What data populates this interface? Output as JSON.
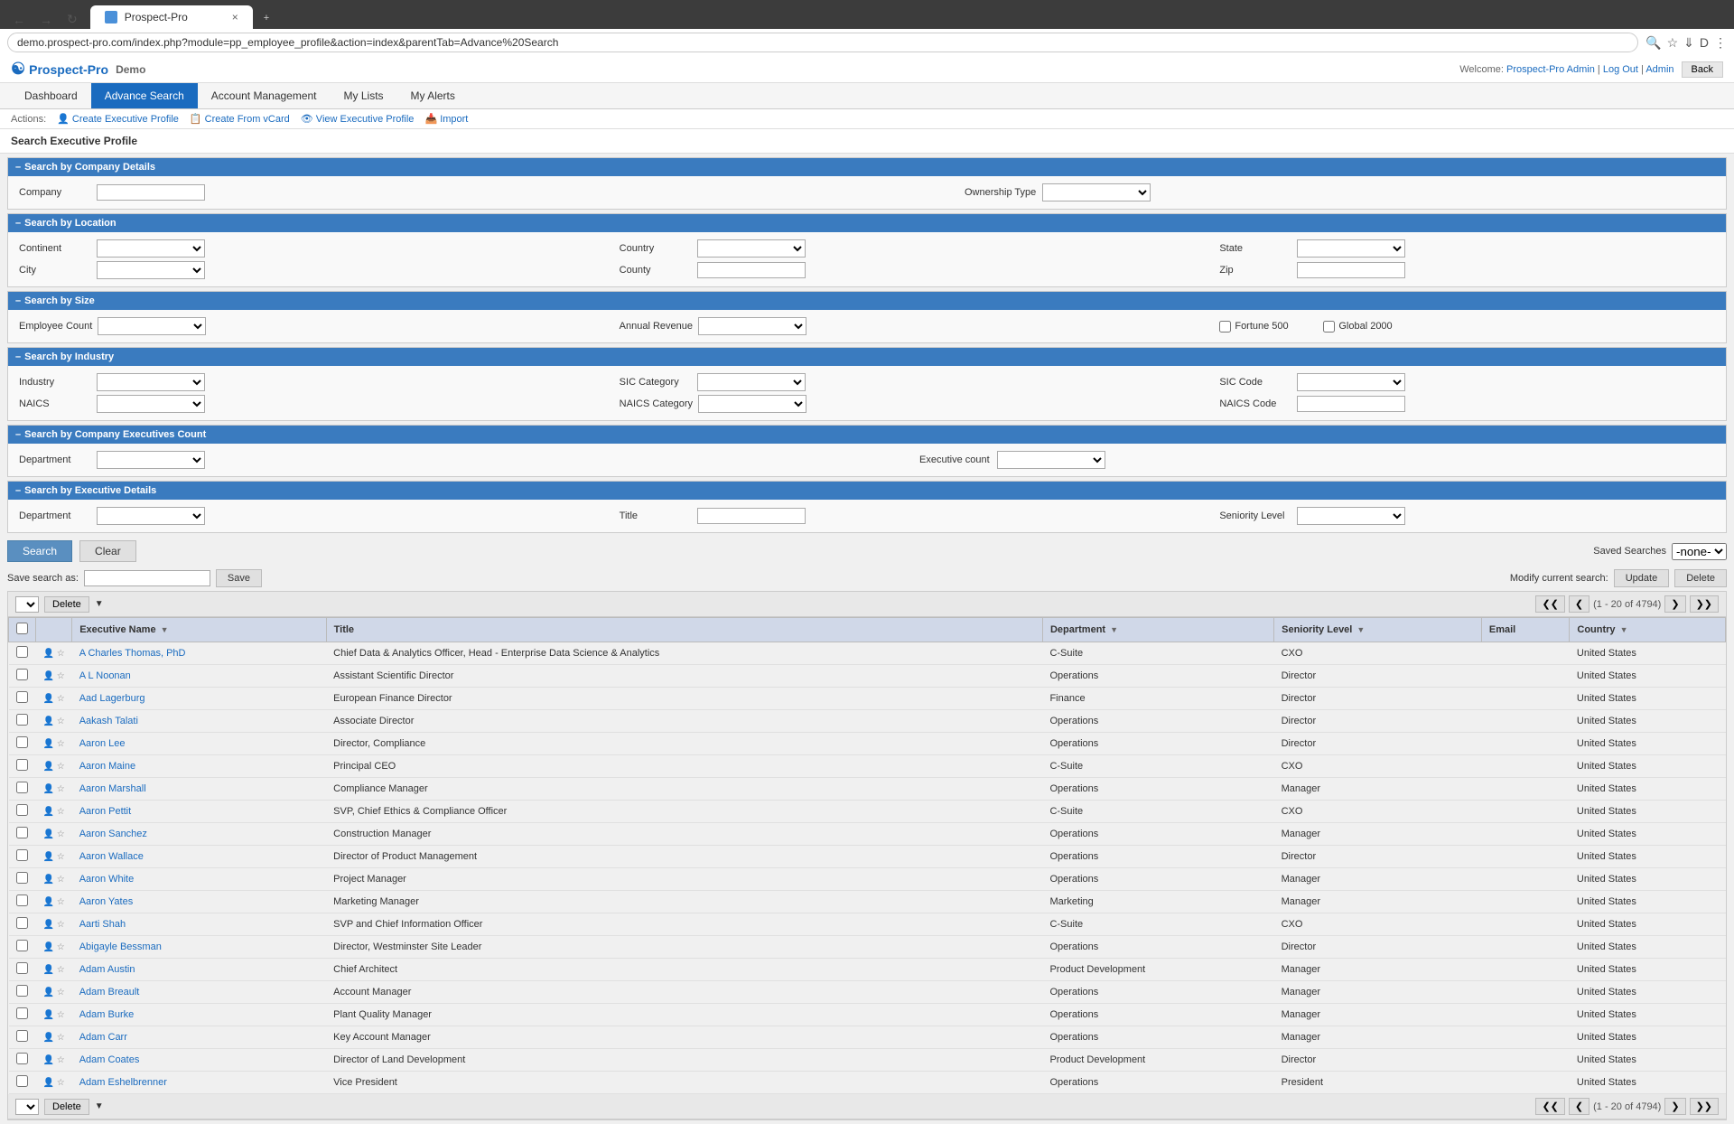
{
  "browser": {
    "tab_title": "Prospect-Pro",
    "url": "demo.prospect-pro.com/index.php?module=pp_employee_profile&action=index&parentTab=Advance%20Search",
    "tab_close": "×",
    "new_tab": "+"
  },
  "app": {
    "logo": "Prospect-Pro",
    "demo_label": "Demo",
    "welcome": "Welcome:",
    "welcome_user": "Prospect-Pro Admin",
    "separator": "|",
    "log_out": "Log Out",
    "admin_link": "Admin",
    "back_btn": "Back"
  },
  "nav": {
    "tabs": [
      {
        "label": "Dashboard",
        "active": false
      },
      {
        "label": "Advance Search",
        "active": true
      },
      {
        "label": "Account Management",
        "active": false
      },
      {
        "label": "My Lists",
        "active": false
      },
      {
        "label": "My Alerts",
        "active": false
      }
    ]
  },
  "actions": {
    "label": "Actions:",
    "items": [
      {
        "icon": "👤",
        "label": "Create Executive Profile"
      },
      {
        "icon": "📋",
        "label": "Create From vCard"
      },
      {
        "icon": "👁",
        "label": "View Executive Profile"
      },
      {
        "icon": "📥",
        "label": "Import"
      }
    ]
  },
  "page_title": "Search Executive Profile",
  "sections": {
    "company_details": {
      "title": "Search by Company Details",
      "company_label": "Company",
      "ownership_label": "Ownership Type"
    },
    "location": {
      "title": "Search by Location",
      "continent_label": "Continent",
      "country_label": "Country",
      "state_label": "State",
      "city_label": "City",
      "county_label": "County",
      "zip_label": "Zip"
    },
    "size": {
      "title": "Search by Size",
      "employee_count_label": "Employee Count",
      "annual_revenue_label": "Annual Revenue",
      "fortune500_label": "Fortune 500",
      "global2000_label": "Global 2000"
    },
    "industry": {
      "title": "Search by Industry",
      "industry_label": "Industry",
      "sic_category_label": "SIC Category",
      "sic_code_label": "SIC Code",
      "naics_label": "NAICS",
      "naics_category_label": "NAICS Category",
      "naics_code_label": "NAICS Code"
    },
    "exec_count": {
      "title": "Search by Company Executives Count",
      "department_label": "Department",
      "exec_count_label": "Executive count"
    },
    "exec_details": {
      "title": "Search by Executive Details",
      "department_label": "Department",
      "title_label": "Title",
      "seniority_label": "Seniority Level"
    }
  },
  "search_btns": {
    "search": "Search",
    "clear": "Clear",
    "saved_searches_label": "Saved Searches",
    "saved_searches_default": "-none-"
  },
  "save_search": {
    "label": "Save search as:",
    "save_btn": "Save",
    "modify_label": "Modify current search:",
    "update_btn": "Update",
    "delete_btn": "Delete"
  },
  "results": {
    "pagination_info": "(1 - 20 of 4794)",
    "columns": [
      "Executive Name",
      "Title",
      "Department",
      "Seniority Level",
      "Email",
      "Country"
    ],
    "delete_btn": "Delete",
    "rows": [
      {
        "name": "A Charles Thomas, PhD",
        "title": "Chief Data & Analytics Officer, Head - Enterprise Data Science & Analytics",
        "department": "C-Suite",
        "seniority": "CXO",
        "email": "",
        "country": "United States"
      },
      {
        "name": "A L Noonan",
        "title": "Assistant Scientific Director",
        "department": "Operations",
        "seniority": "Director",
        "email": "",
        "country": "United States"
      },
      {
        "name": "Aad Lagerburg",
        "title": "European Finance Director",
        "department": "Finance",
        "seniority": "Director",
        "email": "",
        "country": "United States"
      },
      {
        "name": "Aakash Talati",
        "title": "Associate Director",
        "department": "Operations",
        "seniority": "Director",
        "email": "",
        "country": "United States"
      },
      {
        "name": "Aaron Lee",
        "title": "Director, Compliance",
        "department": "Operations",
        "seniority": "Director",
        "email": "",
        "country": "United States"
      },
      {
        "name": "Aaron Maine",
        "title": "Principal CEO",
        "department": "C-Suite",
        "seniority": "CXO",
        "email": "",
        "country": "United States"
      },
      {
        "name": "Aaron Marshall",
        "title": "Compliance Manager",
        "department": "Operations",
        "seniority": "Manager",
        "email": "",
        "country": "United States"
      },
      {
        "name": "Aaron Pettit",
        "title": "SVP, Chief Ethics & Compliance Officer",
        "department": "C-Suite",
        "seniority": "CXO",
        "email": "",
        "country": "United States"
      },
      {
        "name": "Aaron Sanchez",
        "title": "Construction Manager",
        "department": "Operations",
        "seniority": "Manager",
        "email": "",
        "country": "United States"
      },
      {
        "name": "Aaron Wallace",
        "title": "Director of Product Management",
        "department": "Operations",
        "seniority": "Director",
        "email": "",
        "country": "United States"
      },
      {
        "name": "Aaron White",
        "title": "Project Manager",
        "department": "Operations",
        "seniority": "Manager",
        "email": "",
        "country": "United States"
      },
      {
        "name": "Aaron Yates",
        "title": "Marketing Manager",
        "department": "Marketing",
        "seniority": "Manager",
        "email": "",
        "country": "United States"
      },
      {
        "name": "Aarti Shah",
        "title": "SVP and Chief Information Officer",
        "department": "C-Suite",
        "seniority": "CXO",
        "email": "",
        "country": "United States"
      },
      {
        "name": "Abigayle Bessman",
        "title": "Director, Westminster Site Leader",
        "department": "Operations",
        "seniority": "Director",
        "email": "",
        "country": "United States"
      },
      {
        "name": "Adam Austin",
        "title": "Chief Architect",
        "department": "Product Development",
        "seniority": "Manager",
        "email": "",
        "country": "United States"
      },
      {
        "name": "Adam Breault",
        "title": "Account Manager",
        "department": "Operations",
        "seniority": "Manager",
        "email": "",
        "country": "United States"
      },
      {
        "name": "Adam Burke",
        "title": "Plant Quality Manager",
        "department": "Operations",
        "seniority": "Manager",
        "email": "",
        "country": "United States"
      },
      {
        "name": "Adam Carr",
        "title": "Key Account Manager",
        "department": "Operations",
        "seniority": "Manager",
        "email": "",
        "country": "United States"
      },
      {
        "name": "Adam Coates",
        "title": "Director of Land Development",
        "department": "Product Development",
        "seniority": "Director",
        "email": "",
        "country": "United States"
      },
      {
        "name": "Adam Eshelbrenner",
        "title": "Vice President",
        "department": "Operations",
        "seniority": "President",
        "email": "",
        "country": "United States"
      }
    ]
  }
}
